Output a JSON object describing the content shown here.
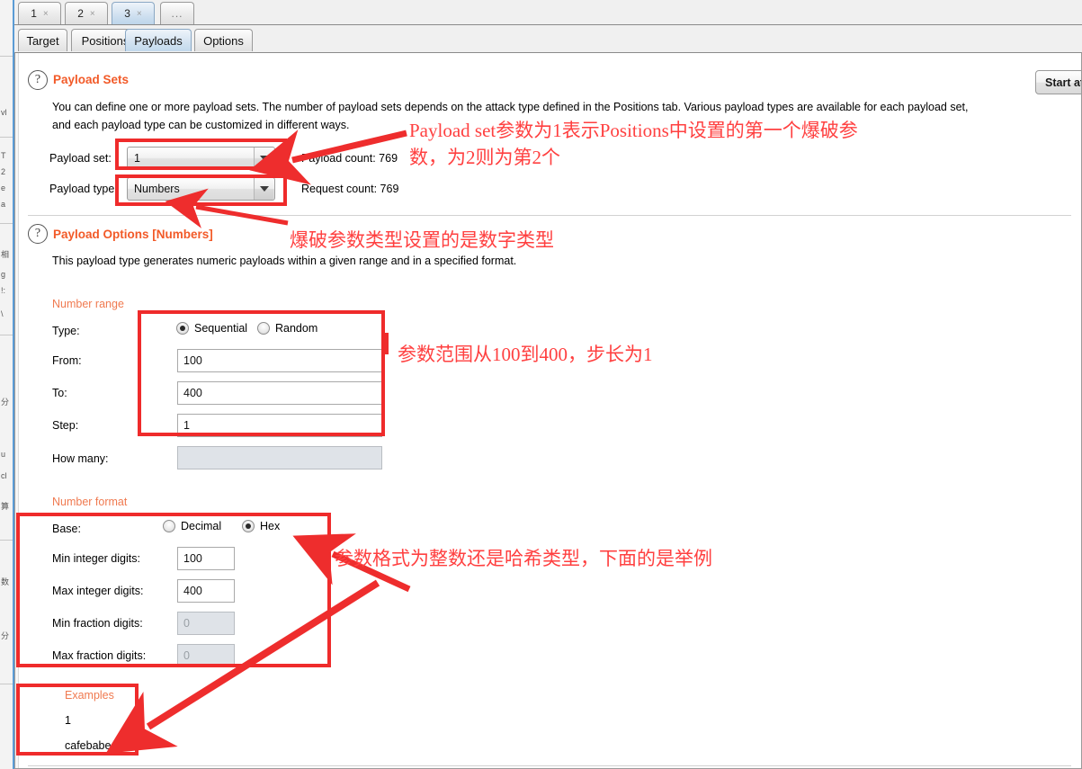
{
  "window": {
    "number_tabs": [
      {
        "label": "1",
        "close": "×",
        "active": false
      },
      {
        "label": "2",
        "close": "×",
        "active": false
      },
      {
        "label": "3",
        "close": "×",
        "active": true
      }
    ],
    "more_tab": "...",
    "section_tabs": [
      {
        "label": "Target",
        "active": false
      },
      {
        "label": "Positions",
        "active": false
      },
      {
        "label": "Payloads",
        "active": true
      },
      {
        "label": "Options",
        "active": false
      }
    ],
    "start_attack_button": "Start att"
  },
  "payload_sets": {
    "help_icon": "?",
    "title": "Payload Sets",
    "description_line1": "You can define one or more payload sets. The number of payload sets depends on the attack type defined in the Positions tab. Various payload types are available for each payload set,",
    "description_line2": "and each payload type can be customized in different ways.",
    "payload_set_label": "Payload set:",
    "payload_set_value": "1",
    "payload_type_label": "Payload type",
    "payload_type_value": "Numbers",
    "payload_count_label": "Payload count: 769",
    "request_count_label": "Request count: 769"
  },
  "payload_options": {
    "help_icon": "?",
    "title": "Payload Options [Numbers]",
    "description": "This payload type generates numeric payloads within a given range and in a specified format.",
    "number_range": {
      "group_label": "Number range",
      "type_label": "Type:",
      "type_options": [
        {
          "label": "Sequential",
          "selected": true
        },
        {
          "label": "Random",
          "selected": false
        }
      ],
      "from_label": "From:",
      "from_value": "100",
      "to_label": "To:",
      "to_value": "400",
      "step_label": "Step:",
      "step_value": "1",
      "how_many_label": "How many:",
      "how_many_value": "",
      "how_many_disabled": true
    },
    "number_format": {
      "group_label": "Number format",
      "base_label": "Base:",
      "base_options": [
        {
          "label": "Decimal",
          "selected": false
        },
        {
          "label": "Hex",
          "selected": true
        }
      ],
      "min_integer_digits_label": "Min integer digits:",
      "min_integer_digits_value": "100",
      "max_integer_digits_label": "Max integer digits:",
      "max_integer_digits_value": "400",
      "min_fraction_digits_label": "Min fraction digits:",
      "min_fraction_digits_value": "0",
      "min_fraction_digits_disabled": true,
      "max_fraction_digits_label": "Max fraction digits:",
      "max_fraction_digits_value": "0",
      "max_fraction_digits_disabled": true
    },
    "examples": {
      "group_label": "Examples",
      "value_1": "1",
      "value_2": "cafebabe"
    }
  },
  "annotations": {
    "accent_color": "#ff4040",
    "box_color": "#ef2b2b",
    "note1_line1": "Payload set参数为1表示Positions中设置的第一个爆破参",
    "note1_line2": "数，为2则为第2个",
    "note2": "爆破参数类型设置的是数字类型",
    "note3": "参数范围从100到400，步长为1",
    "note4": "参数格式为整数还是哈希类型，下面的是举例"
  }
}
